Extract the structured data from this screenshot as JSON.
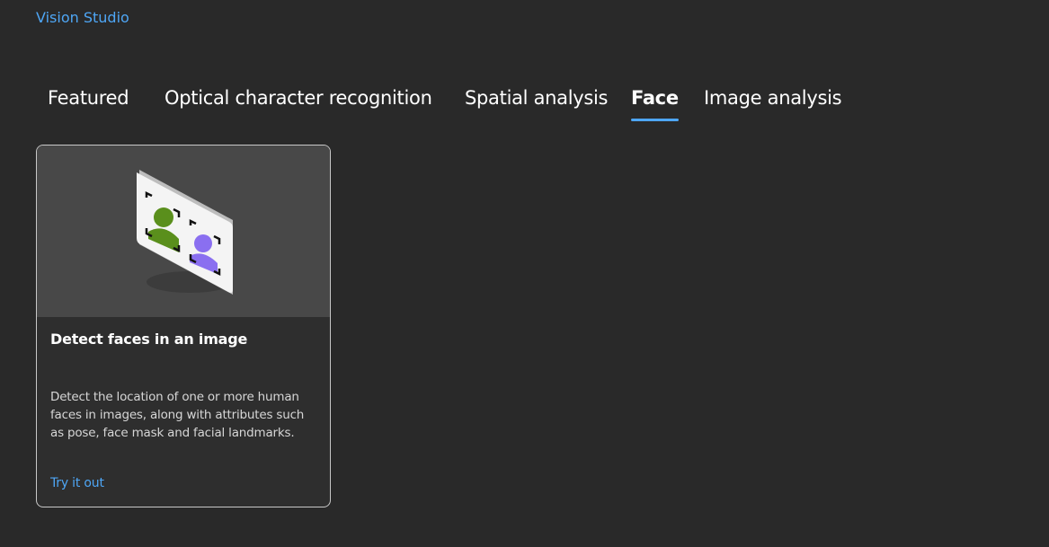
{
  "app": {
    "title": "Vision Studio"
  },
  "tabs": [
    {
      "label": "Featured",
      "active": false
    },
    {
      "label": "Optical character recognition",
      "active": false
    },
    {
      "label": "Spatial analysis",
      "active": false
    },
    {
      "label": "Face",
      "active": true
    },
    {
      "label": "Image analysis",
      "active": false
    }
  ],
  "cards": [
    {
      "illustration": "face-detection-illustration",
      "title": "Detect faces in an image",
      "description": "Detect the location of one or more human faces in images, along with attributes such as pose, face mask and facial landmarks.",
      "link_label": "Try it out"
    }
  ],
  "colors": {
    "background": "#292929",
    "accent": "#4ea6f5",
    "card_background": "#2e2e2e",
    "card_border": "#c8c8c8",
    "hero_background": "#484848",
    "face_green": "#5a8f1c",
    "face_purple": "#8a6ff0"
  }
}
